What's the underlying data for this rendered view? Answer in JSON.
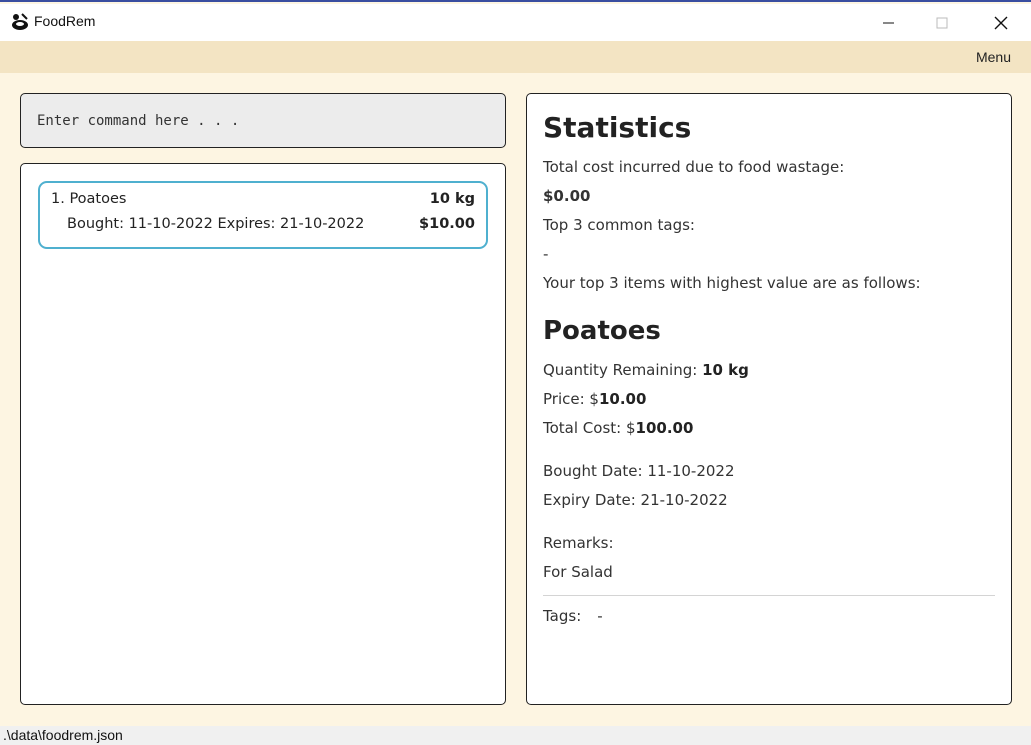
{
  "window": {
    "title": "FoodRem",
    "app_icon": "cooking-pot-icon",
    "accent": "#3a4ea0"
  },
  "menubar": {
    "menu_label": "Menu"
  },
  "command": {
    "placeholder": "Enter command here . . ."
  },
  "food_list": {
    "items": [
      {
        "index": "1.",
        "name": "Poatoes",
        "quantity": "10 kg",
        "bought": "Bought: 11-10-2022",
        "expires": "Expires: 21-10-2022",
        "price": "$10.00"
      }
    ]
  },
  "stats": {
    "title": "Statistics",
    "wastage_label": "Total cost incurred due to food wastage:",
    "wastage_value": "$0.00",
    "tags_label": "Top 3 common tags:",
    "tags_value": "-",
    "top_items_label": "Your top 3 items with highest value are as follows:",
    "detail": {
      "name": "Poatoes",
      "quantity_label": "Quantity Remaining: ",
      "quantity_value": "10 kg",
      "price_label": "Price: $",
      "price_value": "10.00",
      "total_label": "Total Cost: $",
      "total_value": "100.00",
      "bought_date": "Bought Date: 11-10-2022",
      "expiry_date": "Expiry Date: 21-10-2022",
      "remarks_label": "Remarks:",
      "remarks_value": "For Salad",
      "tags_label": "Tags:",
      "tags_value": "-"
    }
  },
  "status_bar": {
    "path": ".\\data\\foodrem.json"
  },
  "colors": {
    "background": "#fdf5e2",
    "menubar": "#f3e4c3",
    "card_border": "#4fb0cf",
    "command_bg": "#ececec"
  }
}
